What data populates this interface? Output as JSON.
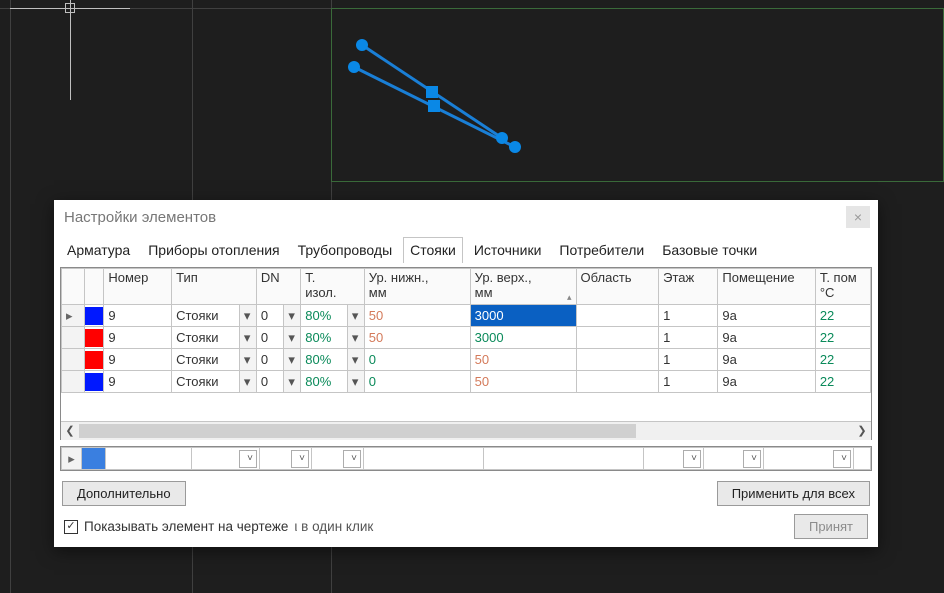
{
  "dialog": {
    "title": "Настройки элементов",
    "close_glyph": "×",
    "tabs": [
      "Арматура",
      "Приборы отопления",
      "Трубопроводы",
      "Стояки",
      "Источники",
      "Потребители",
      "Базовые точки"
    ],
    "active_tab_index": 3,
    "columns": {
      "number": "Номер",
      "type": "Тип",
      "dn": "DN",
      "t_isol": "Т.\nизол.",
      "lvl_bottom": "Ур. нижн.,\nмм",
      "lvl_top": "Ур. верх.,\nмм",
      "area": "Область",
      "floor": "Этаж",
      "room": "Помещение",
      "t_pom": "Т. пом\n°C"
    },
    "rows": [
      {
        "marker": "▸",
        "color": "blue",
        "number": "9",
        "type": "Стояки",
        "dn": "0",
        "t_isol": "80%",
        "lvl_bottom": "50",
        "lvl_top": "3000",
        "lvl_top_selected": true,
        "lvl_bottom_muted": true,
        "lvl_top_style": "",
        "area": "",
        "floor": "1",
        "room": "9a",
        "t_pom": "22"
      },
      {
        "marker": "",
        "color": "red",
        "number": "9",
        "type": "Стояки",
        "dn": "0",
        "t_isol": "80%",
        "lvl_bottom": "50",
        "lvl_top": "3000",
        "lvl_top_selected": false,
        "lvl_bottom_muted": true,
        "lvl_top_style": "teal",
        "area": "",
        "floor": "1",
        "room": "9a",
        "t_pom": "22"
      },
      {
        "marker": "",
        "color": "red",
        "number": "9",
        "type": "Стояки",
        "dn": "0",
        "t_isol": "80%",
        "lvl_bottom": "0",
        "lvl_top": "50",
        "lvl_top_selected": false,
        "lvl_bottom_muted": false,
        "lvl_top_style": "salmon",
        "area": "",
        "floor": "1",
        "room": "9a",
        "t_pom": "22"
      },
      {
        "marker": "",
        "color": "blue",
        "number": "9",
        "type": "Стояки",
        "dn": "0",
        "t_isol": "80%",
        "lvl_bottom": "0",
        "lvl_top": "50",
        "lvl_top_selected": false,
        "lvl_bottom_muted": false,
        "lvl_top_style": "salmon",
        "area": "",
        "floor": "1",
        "room": "9a",
        "t_pom": "22"
      }
    ],
    "buttons": {
      "extra": "Дополнительно",
      "apply_all": "Применить для всех",
      "accept": "Принят"
    },
    "checkbox": {
      "checked": true,
      "label": "Показывать элемент на чертеже",
      "hint": "ι в один клик"
    },
    "scroll": {
      "left": "❮",
      "right": "❯"
    },
    "sort_up": "▴"
  }
}
